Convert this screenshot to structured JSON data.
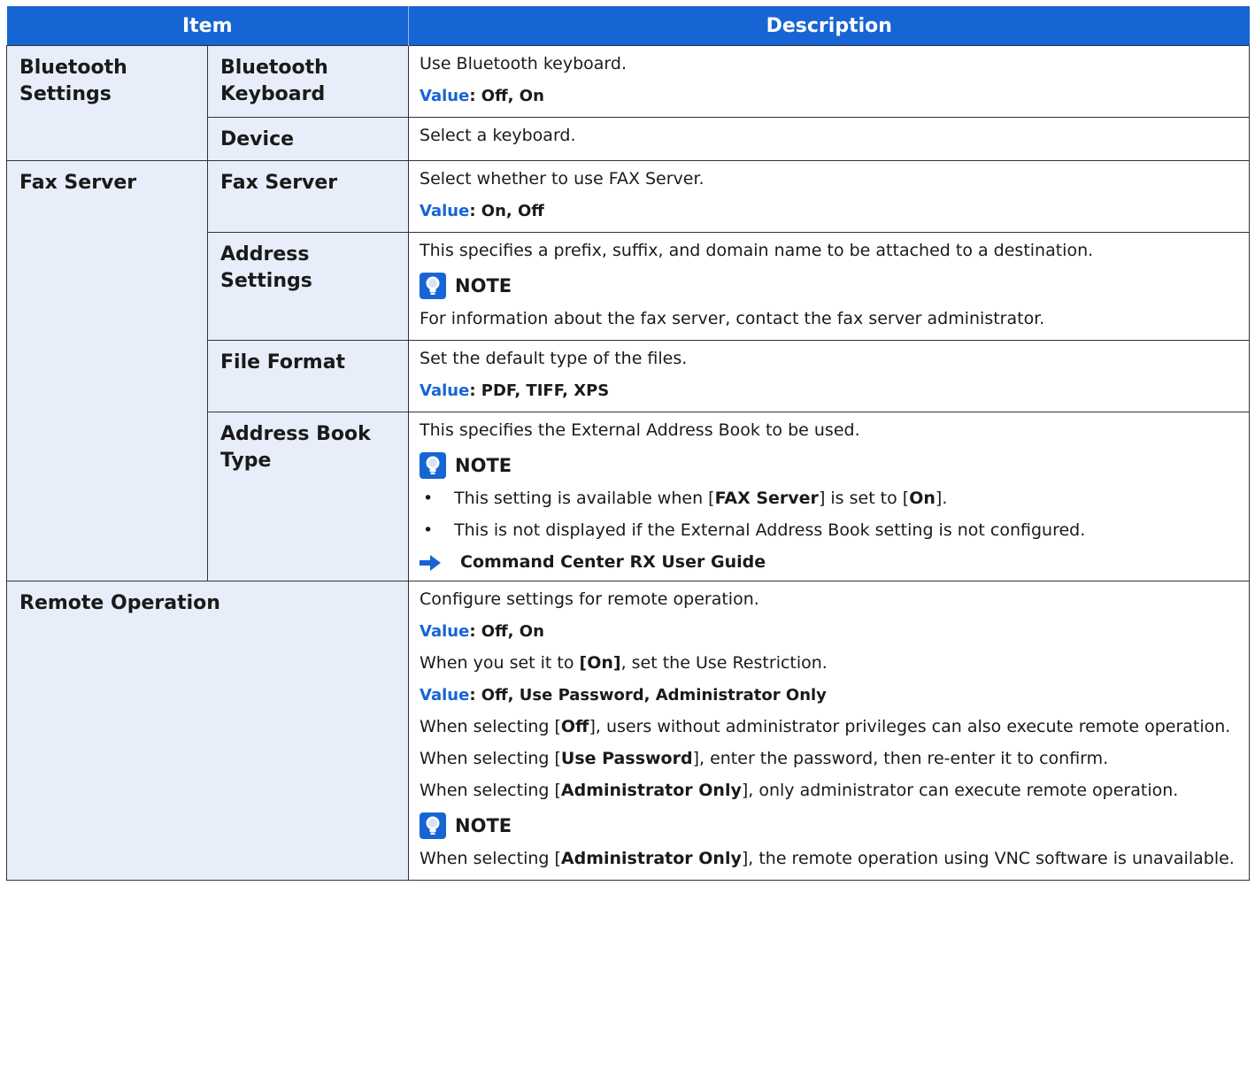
{
  "header": {
    "item": "Item",
    "description": "Description"
  },
  "value_label": "Value",
  "note_label": "NOTE",
  "bluetooth": {
    "category": "Bluetooth Settings",
    "keyboard": {
      "name": "Bluetooth Keyboard",
      "desc": "Use Bluetooth keyboard.",
      "value": ": Off, On"
    },
    "device": {
      "name": "Device",
      "desc": "Select a keyboard."
    }
  },
  "fax": {
    "category": "Fax Server",
    "fax_server": {
      "name": "Fax Server",
      "desc": "Select whether to use FAX Server.",
      "value": ": On, Off"
    },
    "address_settings": {
      "name": "Address Settings",
      "desc": "This specifies a prefix, suffix, and domain name to be attached to a destination.",
      "note": "For information about the fax server, contact the fax server administrator."
    },
    "file_format": {
      "name": "File Format",
      "desc": "Set the default type of the files.",
      "value": ": PDF, TIFF, XPS"
    },
    "address_book_type": {
      "name": "Address Book Type",
      "desc": "This specifies the External Address Book to be used.",
      "bullet1_pre": "This setting is available when [",
      "bullet1_b1": "FAX Server",
      "bullet1_mid": "] is set to [",
      "bullet1_b2": "On",
      "bullet1_post": "].",
      "bullet2": "This is not displayed if the External Address Book setting is not configured.",
      "ref": "Command Center RX User Guide"
    }
  },
  "remote": {
    "name": "Remote Operation",
    "desc": "Configure settings for remote operation.",
    "value1": ": Off, On",
    "restriction_pre": "When you set it to ",
    "restriction_b": "[On]",
    "restriction_post": ", set the Use Restriction.",
    "value2": ": Off, Use Password, Administrator Only",
    "off_pre": "When selecting [",
    "off_b": "Off",
    "off_post": "], users without administrator privileges can also execute remote operation.",
    "pw_pre": "When selecting [",
    "pw_b": "Use Password",
    "pw_post": "], enter the password, then re-enter it to confirm.",
    "admin_pre": "When selecting [",
    "admin_b": "Administrator Only",
    "admin_post": "], only administrator can execute remote operation.",
    "note_pre": "When selecting [",
    "note_b": "Administrator Only",
    "note_post": "], the remote operation using VNC software is unavailable."
  }
}
